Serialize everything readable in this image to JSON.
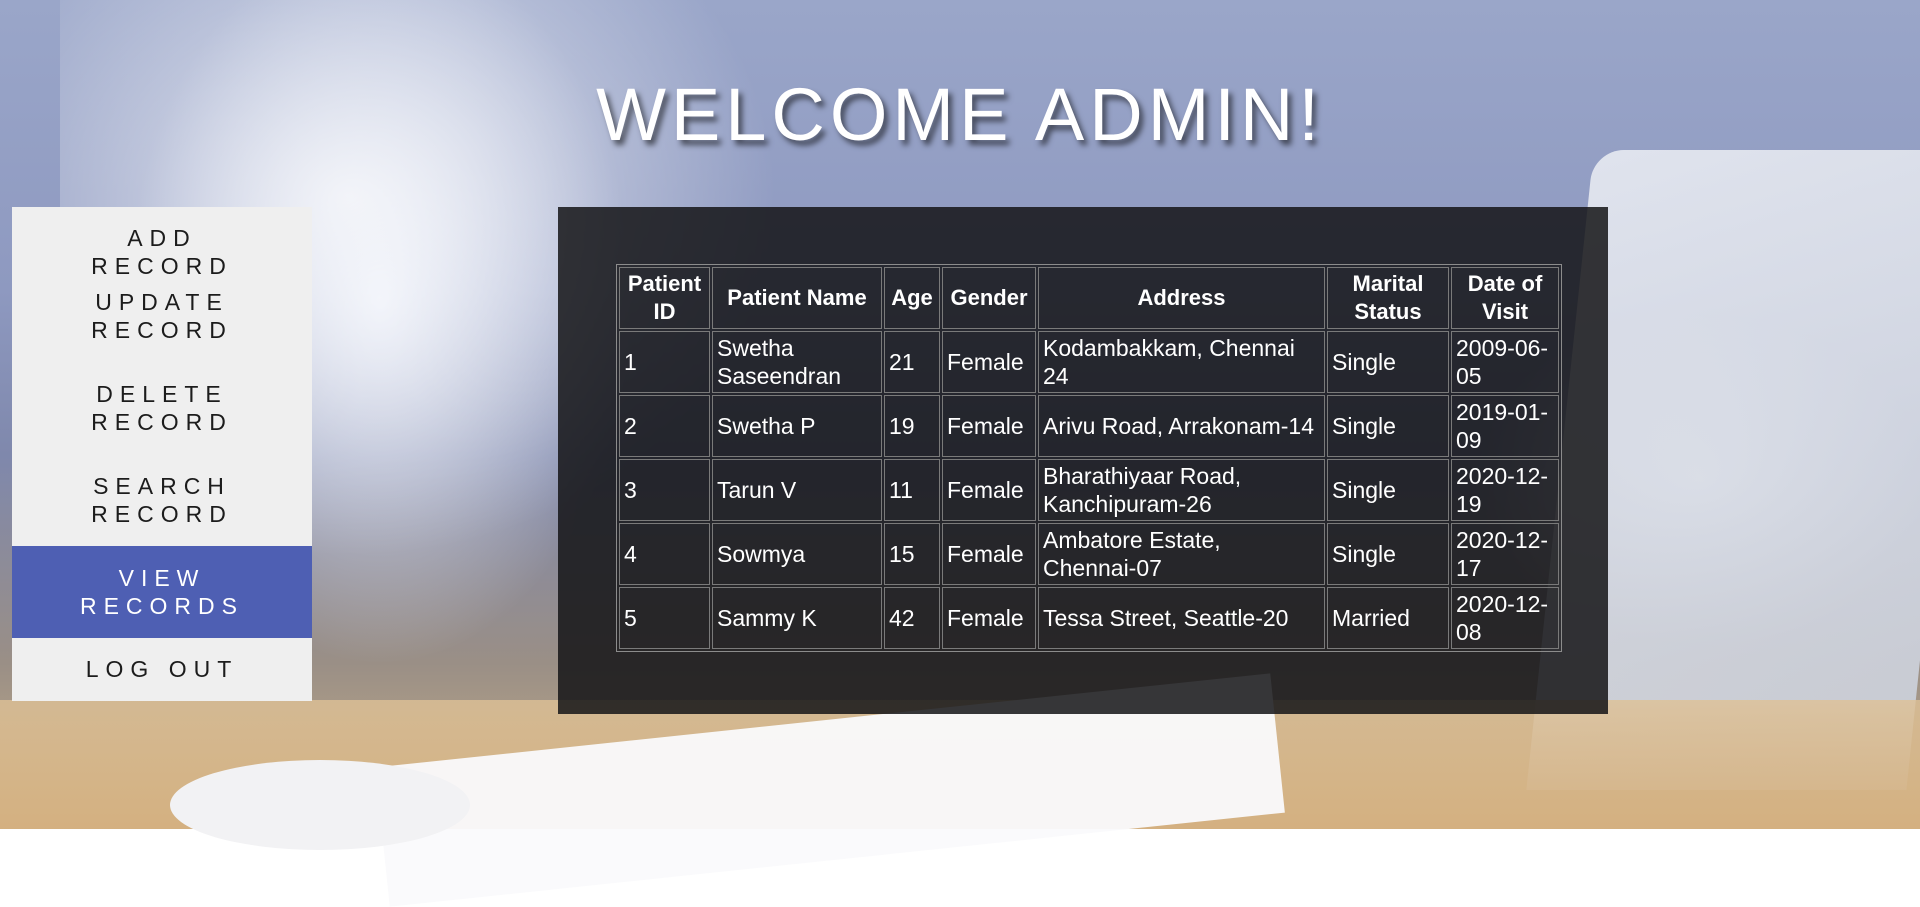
{
  "header": {
    "title": "WELCOME ADMIN!"
  },
  "sidebar": {
    "items": [
      {
        "label": "ADD RECORD",
        "active": false
      },
      {
        "label": "UPDATE RECORD",
        "active": false
      },
      {
        "label": "DELETE RECORD",
        "active": false
      },
      {
        "label": "SEARCH RECORD",
        "active": false
      },
      {
        "label": "VIEW RECORDS",
        "active": true
      },
      {
        "label": "LOG OUT",
        "active": false
      }
    ],
    "active_color": "#4e5fb3"
  },
  "table": {
    "headers": [
      "Patient ID",
      "Patient Name",
      "Age",
      "Gender",
      "Address",
      "Marital Status",
      "Date of Visit"
    ],
    "rows": [
      [
        "1",
        "Swetha Saseendran",
        "21",
        "Female",
        "Kodambakkam, Chennai 24",
        "Single",
        "2009-06-05"
      ],
      [
        "2",
        "Swetha P",
        "19",
        "Female",
        "Arivu Road, Arrakonam-14",
        "Single",
        "2019-01-09"
      ],
      [
        "3",
        "Tarun V",
        "11",
        "Female",
        "Bharathiyaar Road, Kanchipuram-26",
        "Single",
        "2020-12-19"
      ],
      [
        "4",
        "Sowmya",
        "15",
        "Female",
        "Ambatore Estate, Chennai-07",
        "Single",
        "2020-12-17"
      ],
      [
        "5",
        "Sammy K",
        "42",
        "Female",
        "Tessa Street, Seattle-20",
        "Married",
        "2020-12-08"
      ]
    ]
  }
}
